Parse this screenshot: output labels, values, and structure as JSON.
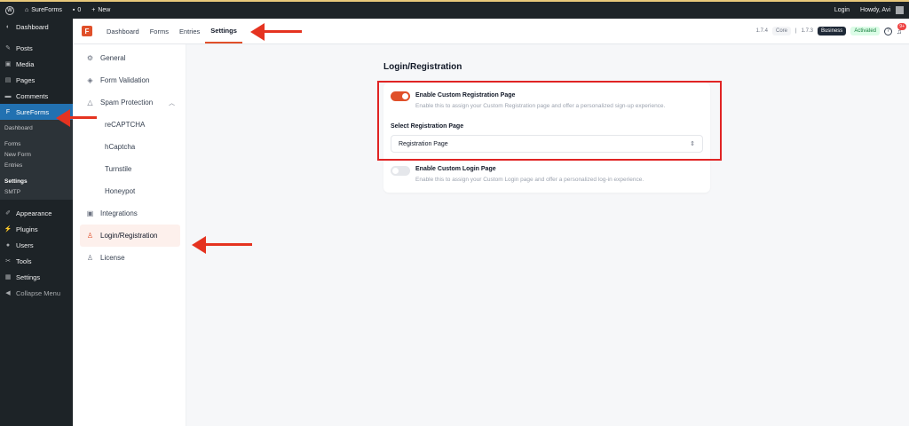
{
  "adminbar": {
    "site_name": "SureForms",
    "comments_count": "0",
    "new_label": "New",
    "login_label": "Login",
    "howdy": "Howdy, Avi"
  },
  "wpmenu": {
    "items_top": [
      {
        "label": "Dashboard",
        "icon": "dashboard-icon"
      }
    ],
    "items_mid": [
      {
        "label": "Posts",
        "icon": "pin-icon"
      },
      {
        "label": "Media",
        "icon": "media-icon"
      },
      {
        "label": "Pages",
        "icon": "page-icon"
      },
      {
        "label": "Comments",
        "icon": "comment-icon"
      }
    ],
    "active": "SureForms",
    "sub_items": [
      "Dashboard",
      "Forms",
      "New Form",
      "Entries",
      "Settings",
      "SMTP"
    ],
    "items_bottom": [
      {
        "label": "Appearance"
      },
      {
        "label": "Plugins"
      },
      {
        "label": "Users"
      },
      {
        "label": "Tools"
      },
      {
        "label": "Settings"
      },
      {
        "label": "Collapse Menu"
      }
    ]
  },
  "sfheader": {
    "tabs": [
      "Dashboard",
      "Forms",
      "Entries",
      "Settings"
    ],
    "active_tab": "Settings",
    "version_1": "1.7.4",
    "core_badge": "Core",
    "version_2": "1.7.3",
    "business_badge": "Business",
    "activated_badge": "Activated",
    "notifications": "9+"
  },
  "settings_sidebar": {
    "general": "General",
    "form_validation": "Form Validation",
    "spam_protection": "Spam Protection",
    "recaptcha": "reCAPTCHA",
    "hcaptcha": "hCaptcha",
    "turnstile": "Turnstile",
    "honeypot": "Honeypot",
    "integrations": "Integrations",
    "login_registration": "Login/Registration",
    "license": "License"
  },
  "main": {
    "title": "Login/Registration",
    "registration": {
      "title": "Enable Custom Registration Page",
      "description": "Enable this to assign your Custom Registration page and offer a personalized sign-up experience.",
      "enabled": true,
      "select_label": "Select Registration Page",
      "select_value": "Registration Page"
    },
    "login": {
      "title": "Enable Custom Login Page",
      "description": "Enable this to assign your Custom Login page and offer a personalized log-in experience.",
      "enabled": false
    }
  },
  "colors": {
    "accent": "#e0502a",
    "wp_dark": "#1d2327",
    "wp_active": "#2271b1",
    "annotation_red": "#e02424"
  }
}
